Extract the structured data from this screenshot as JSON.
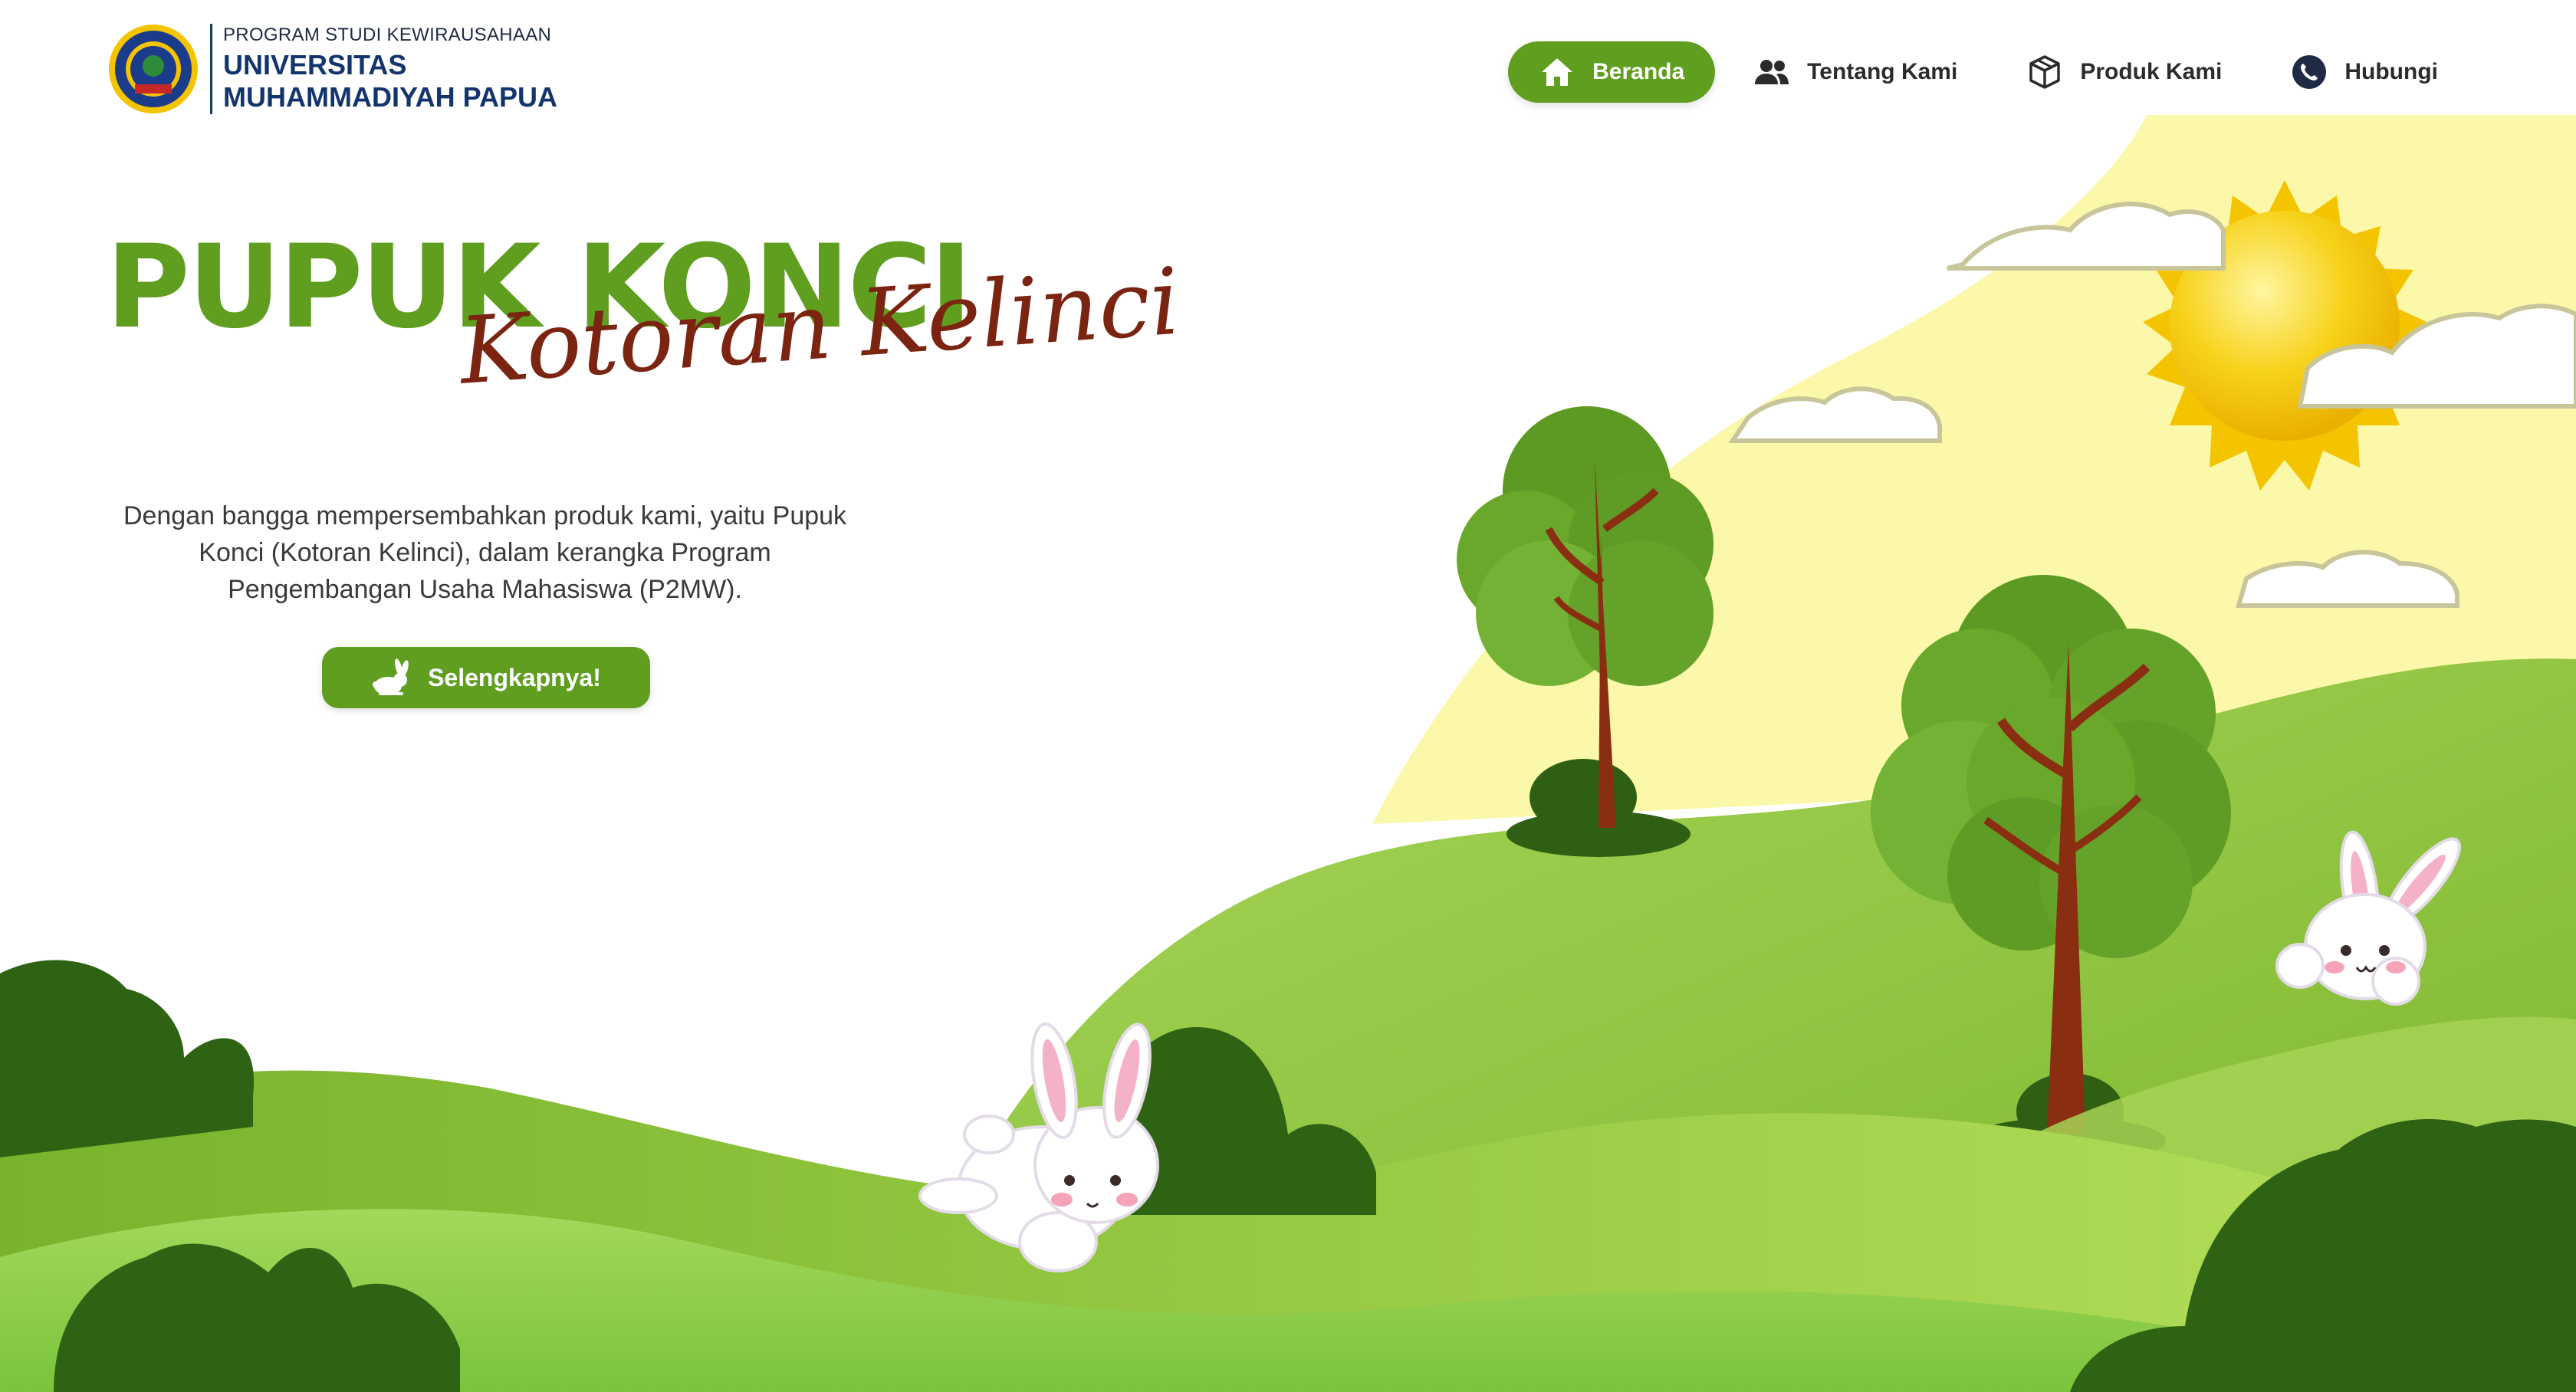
{
  "brand": {
    "program": "PROGRAM STUDI KEWIRAUSAHAAN",
    "university_line1": "UNIVERSITAS",
    "university_line2": "MUHAMMADIYAH PAPUA",
    "logo_icon": "university-seal-icon"
  },
  "nav": {
    "items": [
      {
        "label": "Beranda",
        "icon": "home-icon",
        "active": true
      },
      {
        "label": "Tentang Kami",
        "icon": "users-icon",
        "active": false
      },
      {
        "label": "Produk Kami",
        "icon": "box-icon",
        "active": false
      },
      {
        "label": "Hubungi",
        "icon": "phone-icon",
        "active": false
      }
    ]
  },
  "hero": {
    "title": "PUPUK KONCI",
    "script_subtitle": "Kotoran Kelinci",
    "description": "Dengan bangga mempersembahkan produk kami, yaitu Pupuk Konci (Kotoran Kelinci), dalam kerangka Program Pengembangan Usaha Mahasiswa (P2MW).",
    "cta_label": "Selengkapnya!",
    "cta_icon": "rabbit-icon"
  },
  "colors": {
    "primary_green": "#5f9e1e",
    "navy": "#13356e",
    "script_brown": "#7a2411",
    "sun_yellow": "#f5c400",
    "sky_yellow": "#fbf8a9"
  }
}
